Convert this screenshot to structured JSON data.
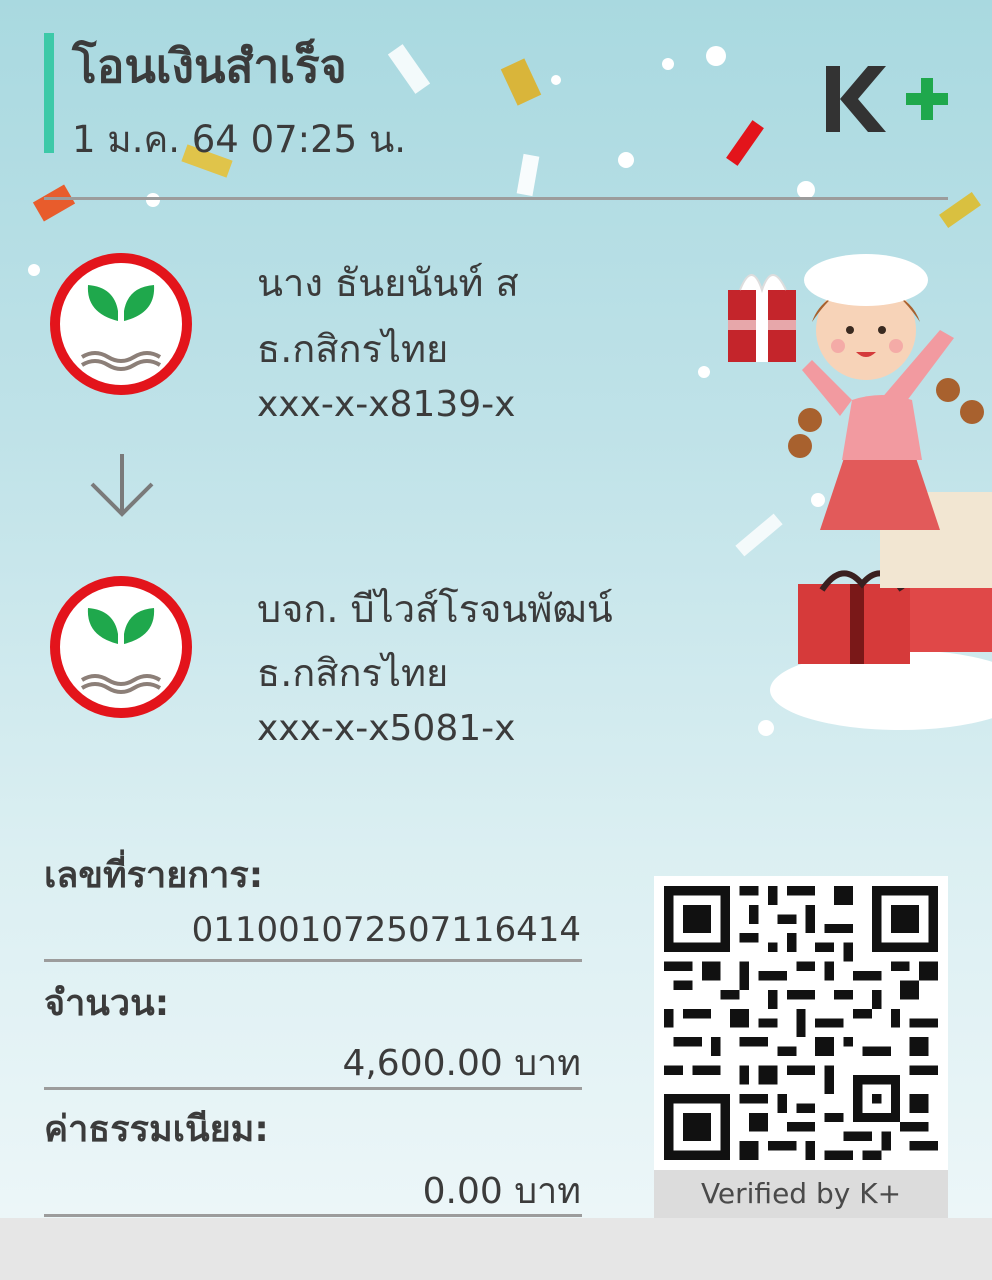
{
  "header": {
    "title": "โอนเงินสำเร็จ",
    "datetime": "1 ม.ค. 64  07:25 น.",
    "logo_text": "K+"
  },
  "sender": {
    "name": "นาง ธันยนันท์ ส",
    "bank": "ธ.กสิกรไทย",
    "account": "xxx-x-x8139-x"
  },
  "receiver": {
    "name": "บจก. บีไวส์โรจนพัฒน์",
    "bank": "ธ.กสิกรไทย",
    "account": "xxx-x-x5081-x"
  },
  "details": {
    "ref_label": "เลขที่รายการ:",
    "ref_value": "011001072507116414",
    "amount_label": "จำนวน:",
    "amount_value": "4,600.00 บาท",
    "fee_label": "ค่าธรรมเนียม:",
    "fee_value": "0.00 บาท"
  },
  "qr": {
    "verified_text": "Verified by K+"
  },
  "colors": {
    "accent": "#3dc9a8",
    "kplus_dark": "#333333",
    "kplus_green": "#1fa84c",
    "kbank_red": "#e3141b",
    "kbank_green": "#1fa84c"
  }
}
